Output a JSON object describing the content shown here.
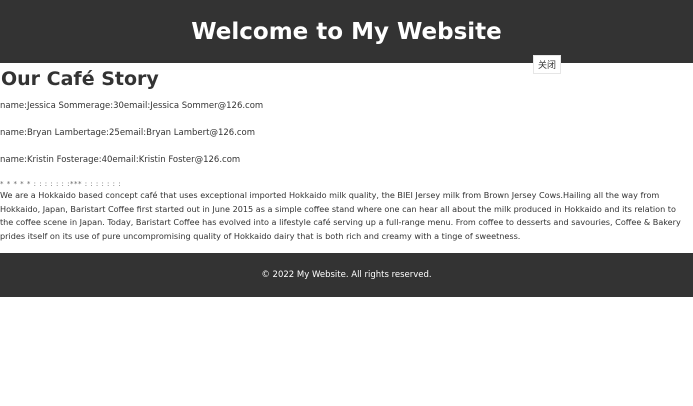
{
  "header": {
    "title": "Welcome to My Website"
  },
  "close_button": {
    "label": "关闭"
  },
  "main": {
    "title": "Our Café Story",
    "users": [
      "name:Jessica Sommerage:30email:Jessica Sommer@126.com",
      "name:Bryan Lambertage:25email:Bryan Lambert@126.com",
      "name:Kristin Fosterage:40email:Kristin Foster@126.com"
    ],
    "star_line": "* * * * * : : : : : : :*** : : : : : : :",
    "story": "We are a Hokkaido based concept café that uses exceptional imported Hokkaido milk quality, the BIEI Jersey milk from Brown Jersey Cows.Hailing all the way from Hokkaido, Japan, Baristart Coffee first started out in June 2015 as a simple coffee stand where one can hear all about the milk produced in Hokkaido and its relation to the coffee scene in Japan. Today, Baristart Coffee has evolved into a lifestyle café serving up a full-range menu. From coffee to desserts and savouries, Coffee & Bakery prides itself on its use of pure uncompromising quality of Hokkaido dairy that is both rich and creamy with a tinge of sweetness."
  },
  "footer": {
    "text": "© 2022 My Website. All rights reserved."
  },
  "colors": {
    "header_bg": "#333333",
    "footer_bg": "#333333",
    "text": "#333333",
    "background": "#ffffff"
  }
}
